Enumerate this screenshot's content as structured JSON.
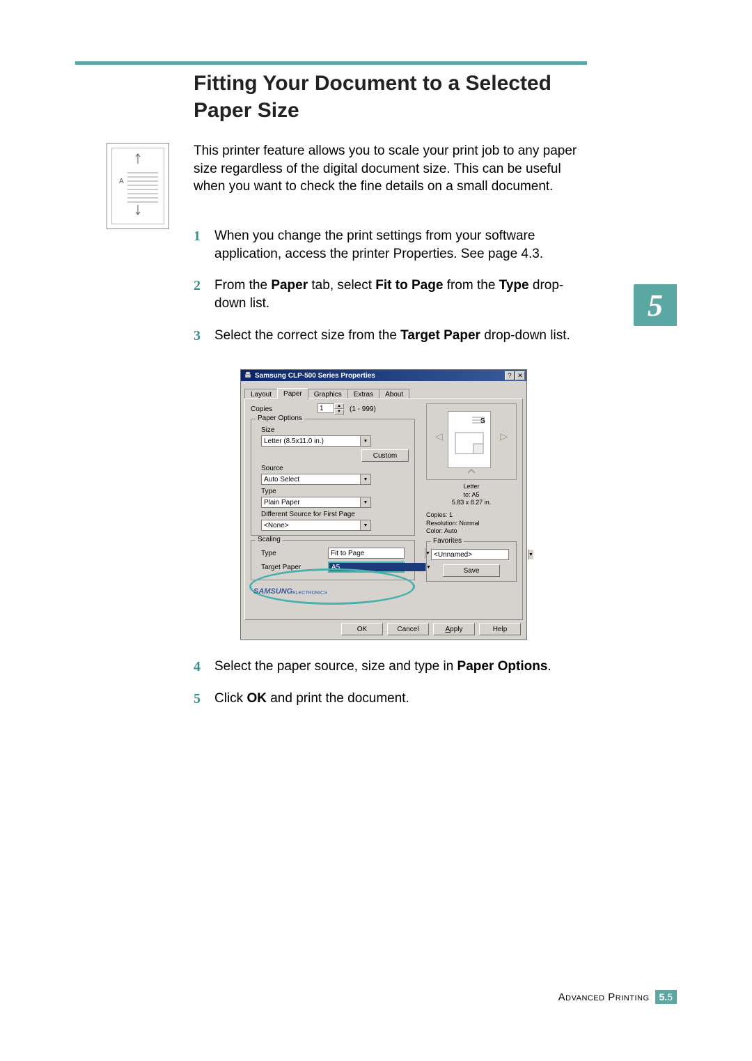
{
  "title": "Fitting Your Document to a Selected Paper Size",
  "intro": "This printer feature allows you to scale your print job to any paper size regardless of the digital document size. This can be useful when you want to check the fine details on a small document.",
  "illus_label": "A",
  "chapter_tab": "5",
  "steps": [
    {
      "num": "1",
      "text_plain": "When you change the print settings from your software application, access the printer Properties. See page 4.3."
    },
    {
      "num": "2",
      "prefix": "From the ",
      "b1": "Paper",
      "mid1": " tab, select ",
      "b2": "Fit to Page",
      "mid2": " from the ",
      "b3": "Type",
      "suffix": " drop-down list."
    },
    {
      "num": "3",
      "prefix": "Select the correct size from the ",
      "b1": "Target Paper",
      "suffix": " drop-down list."
    }
  ],
  "steps_after": [
    {
      "num": "4",
      "prefix": "Select the paper source, size and type in ",
      "b1": "Paper Options",
      "suffix": "."
    },
    {
      "num": "5",
      "prefix": "Click ",
      "b1": "OK",
      "suffix": " and print the document."
    }
  ],
  "dialog": {
    "title": "Samsung CLP-500 Series Properties",
    "tabs": [
      "Layout",
      "Paper",
      "Graphics",
      "Extras",
      "About"
    ],
    "copies_label": "Copies",
    "copies_value": "1",
    "copies_range": "(1 - 999)",
    "paper_options_group": "Paper Options",
    "size_label": "Size",
    "size_value": "Letter (8.5x11.0 in.)",
    "custom_btn": "Custom",
    "source_label": "Source",
    "source_value": "Auto Select",
    "type_label": "Type",
    "type_value": "Plain Paper",
    "diff_source_label": "Different Source for First Page",
    "diff_source_value": "<None>",
    "scaling_group": "Scaling",
    "scaling_type_label": "Type",
    "scaling_type_value": "Fit to Page",
    "target_paper_label": "Target Paper",
    "target_paper_value": "A5",
    "preview_s": "S",
    "preview_caption_1": "Letter",
    "preview_caption_2": "to: A5",
    "preview_caption_3": "5.83 x 8.27 in.",
    "info_copies": "Copies: 1",
    "info_res": "Resolution: Normal",
    "info_color": "Color: Auto",
    "favorites_group": "Favorites",
    "favorites_value": "<Unnamed>",
    "save_btn": "Save",
    "brand": "SAMSUNG",
    "brand_sub": "ELECTRONICS",
    "btn_ok": "OK",
    "btn_cancel": "Cancel",
    "btn_apply": "Apply",
    "btn_help": "Help"
  },
  "footer": {
    "section": "Advanced Printing",
    "chapter": "5.",
    "page": "5"
  }
}
